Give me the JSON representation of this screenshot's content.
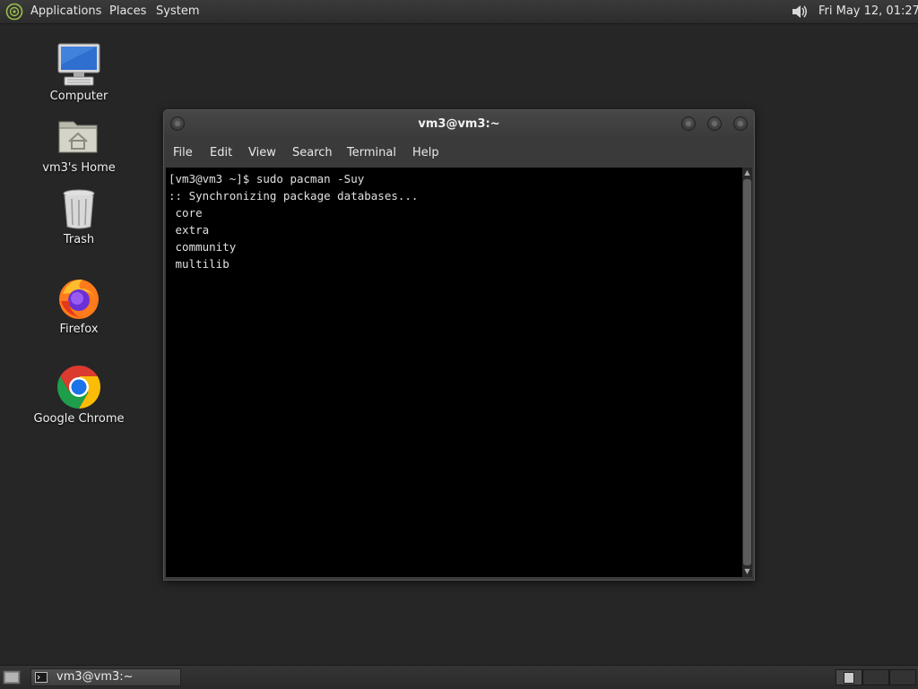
{
  "top_panel": {
    "menus": {
      "applications": "Applications",
      "places": "Places",
      "system": "System"
    },
    "clock": "Fri May 12, 01:27"
  },
  "desktop": {
    "icons": [
      {
        "label": "Computer",
        "icon": "computer-icon"
      },
      {
        "label": "vm3's Home",
        "icon": "home-folder-icon"
      },
      {
        "label": "Trash",
        "icon": "trash-icon"
      },
      {
        "label": "Firefox",
        "icon": "firefox-icon"
      },
      {
        "label": "Google Chrome",
        "icon": "chrome-icon"
      }
    ]
  },
  "terminal": {
    "title": "vm3@vm3:~",
    "menu": [
      "File",
      "Edit",
      "View",
      "Search",
      "Terminal",
      "Help"
    ],
    "lines": [
      "[vm3@vm3 ~]$ sudo pacman -Suy",
      ":: Synchronizing package databases...",
      " core",
      " extra",
      " community",
      " multilib"
    ]
  },
  "taskbar": {
    "task_label": "vm3@vm3:~"
  },
  "colors": {
    "desktop_bg": "#262626",
    "panel_bg": "#2f2f2f",
    "terminal_bg": "#000000",
    "terminal_fg": "#e0e0e0"
  }
}
